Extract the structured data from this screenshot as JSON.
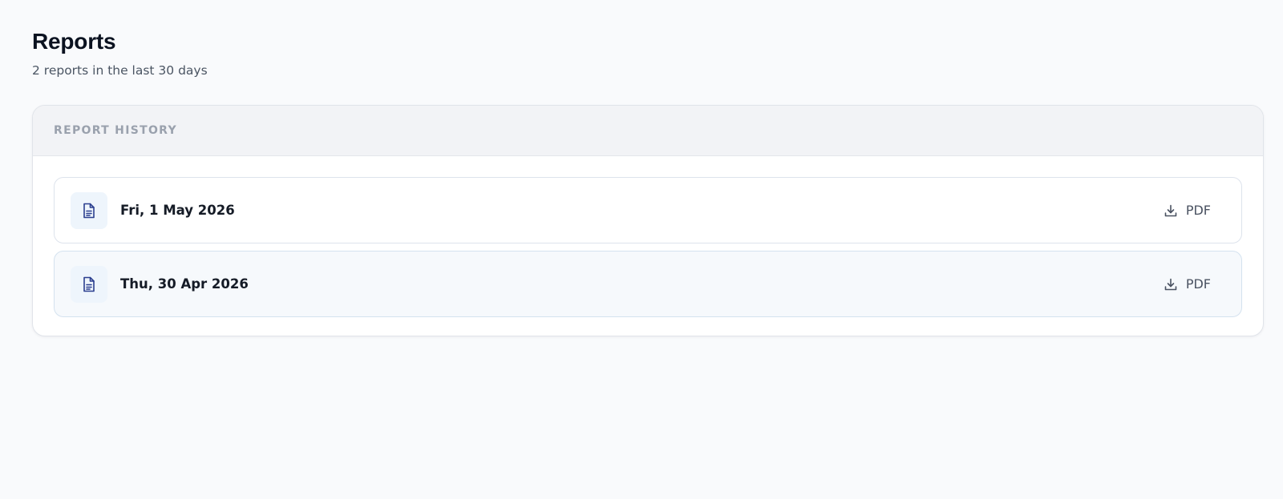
{
  "header": {
    "title": "Reports",
    "subtitle": "2 reports in the last 30 days"
  },
  "card": {
    "title": "REPORT HISTORY"
  },
  "reports": [
    {
      "date": "Fri, 1 May 2026",
      "download_label": "PDF",
      "icon": "file-text-icon",
      "download_icon": "download-icon"
    },
    {
      "date": "Thu, 30 Apr 2026",
      "download_label": "PDF",
      "icon": "file-text-icon",
      "download_icon": "download-icon"
    }
  ],
  "colors": {
    "accent": "#2b3f8f",
    "icon_bg": "#eef5fc",
    "page_bg": "#f9fafc"
  }
}
